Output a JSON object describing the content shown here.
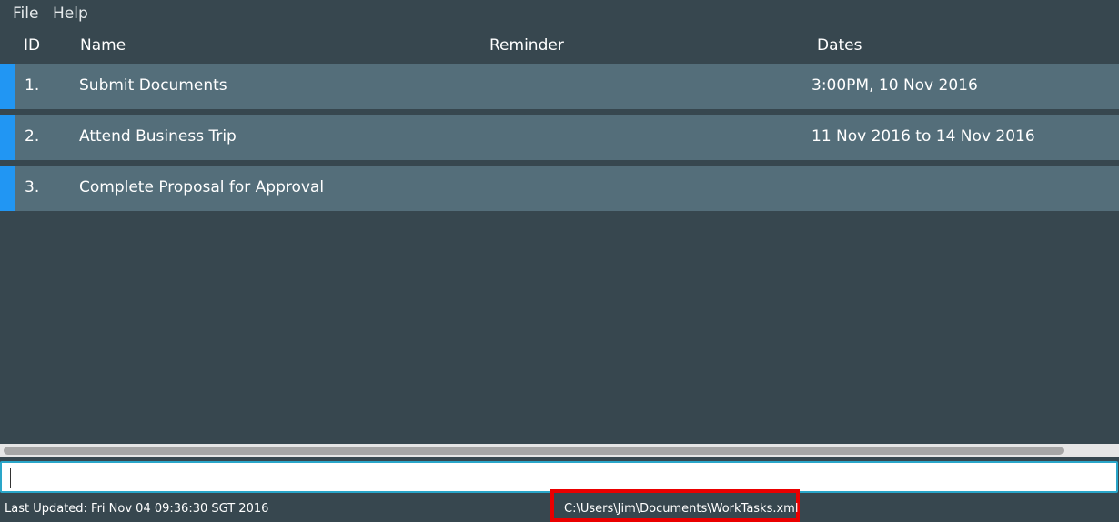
{
  "menu": {
    "items": [
      "File",
      "Help"
    ]
  },
  "columns": {
    "id": "ID",
    "name": "Name",
    "reminder": "Reminder",
    "dates": "Dates"
  },
  "tasks": [
    {
      "id": "1.",
      "name": "Submit Documents",
      "reminder": "",
      "dates": "3:00PM, 10 Nov 2016"
    },
    {
      "id": "2.",
      "name": "Attend Business Trip",
      "reminder": "",
      "dates": "11 Nov 2016 to 14 Nov 2016"
    },
    {
      "id": "3.",
      "name": "Complete Proposal for Approval",
      "reminder": "",
      "dates": ""
    }
  ],
  "command": {
    "value": "",
    "placeholder": ""
  },
  "status": {
    "last_updated": "Last Updated: Fri Nov 04 09:36:30 SGT 2016",
    "file_path": "C:\\Users\\Jim\\Documents\\WorkTasks.xml"
  },
  "colors": {
    "background": "#37474f",
    "row": "#546e7a",
    "accent": "#2196f3",
    "highlight_box": "#ea0000",
    "input_border": "#2aa6c9"
  }
}
